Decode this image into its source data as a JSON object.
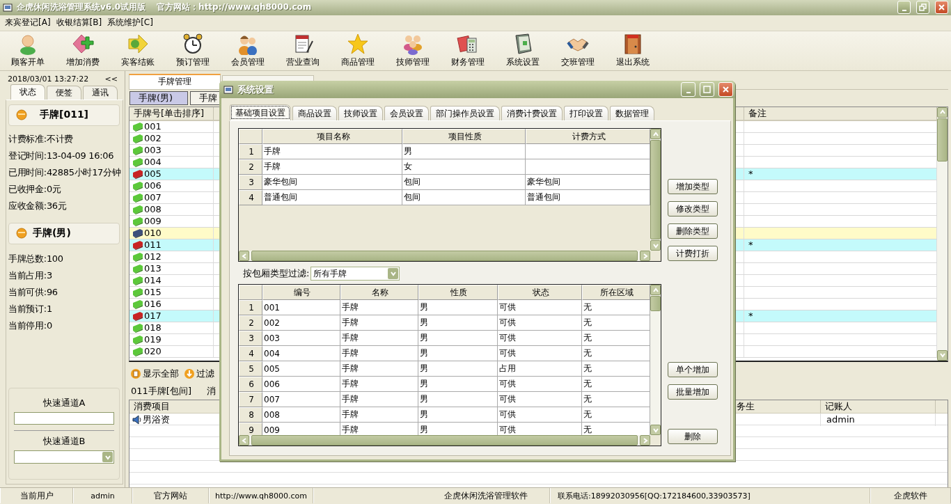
{
  "window": {
    "title": "企虎休闲洗浴管理系统v6.0试用版",
    "site": "官方网站：http://www.qh8000.com"
  },
  "menu": [
    "来宾登记[A]",
    "收银结算[B]",
    "系统维护[C]"
  ],
  "toolbar": [
    "顾客开单",
    "增加消费",
    "宾客结账",
    "预订管理",
    "会员管理",
    "营业查询",
    "商品管理",
    "技师管理",
    "财务管理",
    "系统设置",
    "交班管理",
    "退出系统"
  ],
  "left_panel": {
    "datetime": "2018/03/01 13:27:22",
    "collapse": "<<",
    "tabs": [
      {
        "label": "状态",
        "selected": true
      },
      {
        "label": "便签",
        "selected": false
      },
      {
        "label": "通讯",
        "selected": false
      }
    ],
    "card": "手牌[011]",
    "details": [
      "计费标准:不计费",
      "登记时间:13-04-09 16:06",
      "已用时间:42885小时17分钟",
      "已收押金:0元",
      "应收金额:36元"
    ],
    "group": "手牌(男)",
    "stats": [
      "手牌总数:100",
      "当前占用:3",
      "当前可供:96",
      "当前预订:1",
      "当前停用:0"
    ],
    "quick_a": "快速通道A",
    "quick_b": "快速通道B"
  },
  "main": {
    "tabs": [
      {
        "label": "手牌管理",
        "selected": true
      },
      {
        "selected": false
      }
    ],
    "subtabs": [
      {
        "label": "手牌(男)",
        "selected": true
      },
      {
        "label": "手牌",
        "selected": false
      }
    ],
    "grid": {
      "columns": [
        "手牌号[单击排序]",
        "备注"
      ],
      "rows": [
        {
          "number": "001",
          "occupied": false,
          "reserved": false
        },
        {
          "number": "002",
          "occupied": false,
          "reserved": false
        },
        {
          "number": "003",
          "occupied": false,
          "reserved": false
        },
        {
          "number": "004",
          "occupied": false,
          "reserved": false
        },
        {
          "number": "005",
          "occupied": true,
          "reserved": false,
          "note": "*"
        },
        {
          "number": "006",
          "occupied": false,
          "reserved": false
        },
        {
          "number": "007",
          "occupied": false,
          "reserved": false
        },
        {
          "number": "008",
          "occupied": false,
          "reserved": false
        },
        {
          "number": "009",
          "occupied": false,
          "reserved": false
        },
        {
          "number": "010",
          "occupied": false,
          "reserved": true
        },
        {
          "number": "011",
          "occupied": true,
          "reserved": false,
          "note": "*"
        },
        {
          "number": "012",
          "occupied": false,
          "reserved": false
        },
        {
          "number": "013",
          "occupied": false,
          "reserved": false
        },
        {
          "number": "014",
          "occupied": false,
          "reserved": false
        },
        {
          "number": "015",
          "occupied": false,
          "reserved": false
        },
        {
          "number": "016",
          "occupied": false,
          "reserved": false
        },
        {
          "number": "017",
          "occupied": true,
          "reserved": false,
          "note": "*"
        },
        {
          "number": "018",
          "occupied": false,
          "reserved": false
        },
        {
          "number": "019",
          "occupied": false,
          "reserved": false
        },
        {
          "number": "020",
          "occupied": false,
          "reserved": false
        }
      ]
    },
    "actions": [
      "显示全部",
      "过滤"
    ],
    "selection": {
      "title": "011手牌[包间]",
      "column_2": "消"
    },
    "charges": {
      "columns": [
        "消费项目",
        "务生",
        "记账人"
      ],
      "rows": [
        {
          "item": "男浴资",
          "operator": "admin"
        }
      ]
    }
  },
  "status_bar": [
    "当前用户",
    "admin",
    "官方网站",
    "http://www.qh8000.com",
    "企虎休闲洗浴管理软件",
    "联系电话:18992030956[QQ:172184600,33903573]",
    "企虎软件"
  ],
  "dialog": {
    "title": "系统设置",
    "tabs": [
      {
        "label": "基础项目设置",
        "selected": true
      },
      {
        "label": "商品设置",
        "selected": false
      },
      {
        "label": "技师设置",
        "selected": false
      },
      {
        "label": "会员设置",
        "selected": false
      },
      {
        "label": "部门操作员设置",
        "selected": false
      },
      {
        "label": "消费计费设置",
        "selected": false
      },
      {
        "label": "打印设置",
        "selected": false
      },
      {
        "label": "数据管理",
        "selected": false
      }
    ],
    "types": {
      "columns": [
        "项目名称",
        "项目性质",
        "计费方式"
      ],
      "rows": [
        {
          "index": "1",
          "cells": [
            "手牌",
            "男",
            null
          ]
        },
        {
          "index": "2",
          "cells": [
            "手牌",
            "女",
            null
          ]
        },
        {
          "index": "3",
          "cells": [
            "豪华包间",
            "包间",
            "豪华包间"
          ]
        },
        {
          "index": "4",
          "cells": [
            "普通包间",
            "包间",
            "普通包间"
          ]
        }
      ]
    },
    "type_buttons": [
      "增加类型",
      "修改类型",
      "删除类型",
      "计费打折"
    ],
    "filter": {
      "label": "按包厢类型过滤:",
      "value": "所有手牌"
    },
    "items": {
      "columns": [
        "编号",
        "名称",
        "性质",
        "状态",
        "所在区域"
      ],
      "rows": [
        {
          "index": "1",
          "cells": [
            "001",
            "手牌",
            "男",
            "可供",
            "无"
          ]
        },
        {
          "index": "2",
          "cells": [
            "002",
            "手牌",
            "男",
            "可供",
            "无"
          ]
        },
        {
          "index": "3",
          "cells": [
            "003",
            "手牌",
            "男",
            "可供",
            "无"
          ]
        },
        {
          "index": "4",
          "cells": [
            "004",
            "手牌",
            "男",
            "可供",
            "无"
          ]
        },
        {
          "index": "5",
          "cells": [
            "005",
            "手牌",
            "男",
            "占用",
            "无"
          ]
        },
        {
          "index": "6",
          "cells": [
            "006",
            "手牌",
            "男",
            "可供",
            "无"
          ]
        },
        {
          "index": "7",
          "cells": [
            "007",
            "手牌",
            "男",
            "可供",
            "无"
          ]
        },
        {
          "index": "8",
          "cells": [
            "008",
            "手牌",
            "男",
            "可供",
            "无"
          ]
        },
        {
          "index": "9",
          "cells": [
            "009",
            "手牌",
            "男",
            "可供",
            "无"
          ]
        }
      ]
    },
    "item_buttons": [
      "单个增加",
      "批量增加",
      "删除"
    ]
  }
}
